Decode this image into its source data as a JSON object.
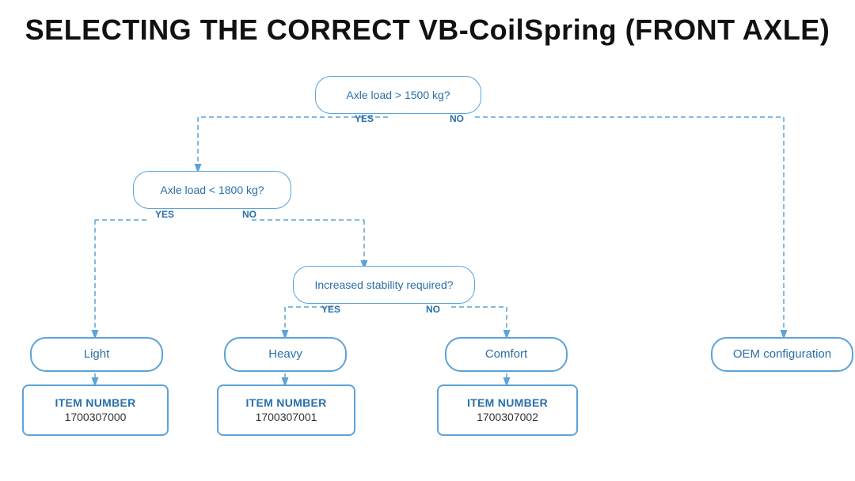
{
  "title": "SELECTING THE CORRECT VB-CoilSpring (FRONT AXLE)",
  "nodes": {
    "question1": {
      "text": "Axle load > 1500 kg?",
      "yes": "YES",
      "no": "NO"
    },
    "question2": {
      "text": "Axle load < 1800 kg?",
      "yes": "YES",
      "no": "NO"
    },
    "question3": {
      "text": "Increased stability required?",
      "yes": "YES",
      "no": "NO"
    },
    "result_light": {
      "text": "Light"
    },
    "result_heavy": {
      "text": "Heavy"
    },
    "result_comfort": {
      "text": "Comfort"
    },
    "result_oem": {
      "text": "OEM configuration"
    },
    "item0": {
      "label": "ITEM NUMBER",
      "number": "1700307000"
    },
    "item1": {
      "label": "ITEM NUMBER",
      "number": "1700307001"
    },
    "item2": {
      "label": "ITEM NUMBER",
      "number": "1700307002"
    }
  },
  "colors": {
    "blue": "#2a6fa8",
    "border": "#5ba3d9"
  }
}
